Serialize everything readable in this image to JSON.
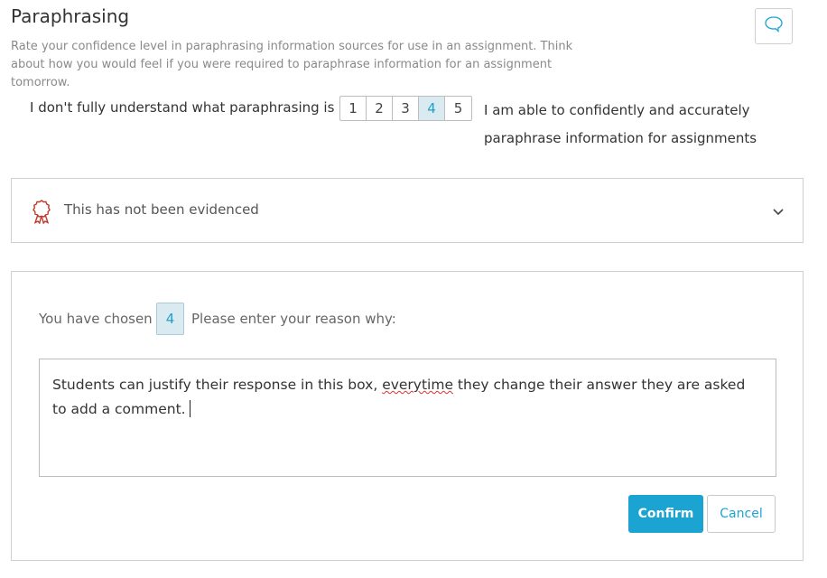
{
  "header": {
    "title": "Paraphrasing",
    "subtitle": "Rate your confidence level in paraphrasing information sources for use in an assignment. Think about how you would feel if you were required to paraphrase information for an assignment tomorrow."
  },
  "comment_button": {
    "icon": "speech-bubble-icon"
  },
  "scale": {
    "low_label": "I don't fully understand what paraphrasing is",
    "options": [
      "1",
      "2",
      "3",
      "4",
      "5"
    ],
    "selected": "4",
    "high_label": "I am able to confidently and accurately paraphrase information for assignments"
  },
  "evidence": {
    "icon": "award-ribbon-icon",
    "text": "This has not been evidenced",
    "toggle_icon": "chevron-down-icon"
  },
  "reason": {
    "chosen_label": "You have chosen",
    "chosen_value": "4",
    "prompt": "Please enter your reason why:",
    "text_before": "Students can justify their response in this box, ",
    "text_misspelled": "everytime",
    "text_after": " they change their answer they are asked to add a comment.",
    "confirm_label": "Confirm",
    "cancel_label": "Cancel"
  },
  "colors": {
    "accent": "#1ba4d2",
    "selected_bg": "#d9ebf1",
    "ribbon": "#c0392b"
  }
}
